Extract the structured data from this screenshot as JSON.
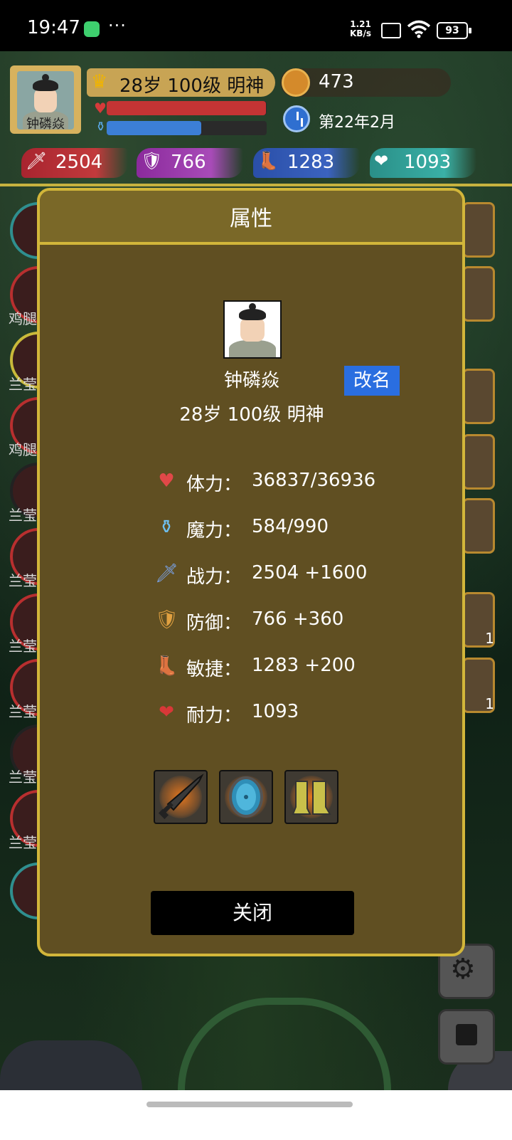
{
  "status_bar": {
    "time": "19:47",
    "more": "···",
    "speed_top": "1.21",
    "speed_bottom": "KB/s",
    "battery": "93"
  },
  "player": {
    "name": "钟磷焱",
    "level_text": "28岁 100级 明神",
    "hp_fraction": 0.997,
    "mp_fraction": 0.59
  },
  "resources": {
    "gold": "473",
    "date": "第22年2月"
  },
  "stats_bar": {
    "attack": "2504",
    "defense": "766",
    "agility": "1283",
    "endurance": "1093"
  },
  "side_labels": [
    "鸡腿",
    "兰莹",
    "鸡腿",
    "兰莹",
    "兰莹",
    "兰莹",
    "兰莹",
    "兰莹",
    "兰莹"
  ],
  "potion_counts": [
    "1",
    "1"
  ],
  "modal": {
    "title": "属性",
    "name": "钟磷焱",
    "rename_label": "改名",
    "level_text": "28岁 100级 明神",
    "attributes": [
      {
        "icon": "heart-icon",
        "label": "体力：",
        "value": "36837/36936"
      },
      {
        "icon": "mana-potion-icon",
        "label": "魔力：",
        "value": "584/990"
      },
      {
        "icon": "sword-icon",
        "label": "战力：",
        "value": "2504 +1600"
      },
      {
        "icon": "shield-icon",
        "label": "防御：",
        "value": "766 +360"
      },
      {
        "icon": "boot-icon",
        "label": "敏捷：",
        "value": "1283 +200"
      },
      {
        "icon": "heart-plus-icon",
        "label": "耐力：",
        "value": "1093"
      }
    ],
    "equipment": [
      "sword-equipment-icon",
      "shield-equipment-icon",
      "boots-equipment-icon"
    ],
    "close_label": "关闭"
  },
  "colors": {
    "modal_bg": "#604f22",
    "modal_border": "#d2b63a",
    "rename_button": "#2a6ee0",
    "hp": "#c43434",
    "mp": "#3c7fd6"
  }
}
